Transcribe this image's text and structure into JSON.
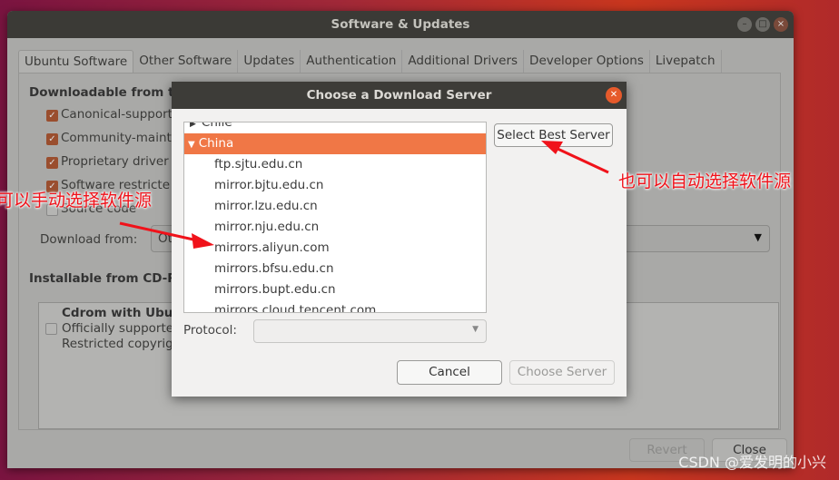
{
  "window": {
    "title": "Software & Updates",
    "controls": [
      "minimize",
      "maximize",
      "close"
    ]
  },
  "tabs": [
    "Ubuntu Software",
    "Other Software",
    "Updates",
    "Authentication",
    "Additional Drivers",
    "Developer Options",
    "Livepatch"
  ],
  "main": {
    "downloadable_heading": "Downloadable from th",
    "checkboxes": [
      {
        "label": "Canonical-support",
        "checked": true
      },
      {
        "label": "Community-mainta",
        "checked": true
      },
      {
        "label": "Proprietary driver",
        "checked": true
      },
      {
        "label": "Software restricte",
        "checked": true
      },
      {
        "label": "Source code",
        "checked": false
      }
    ],
    "download_from_label": "Download from:",
    "download_from_value": "Ot",
    "cdrom_heading": "Installable from CD-R",
    "cdrom": {
      "title": "Cdrom with Ubun",
      "line1": "Officially supporte",
      "line2": "Restricted copyrig",
      "checked": false
    },
    "revert": "Revert",
    "close": "Close"
  },
  "dialog": {
    "title": "Choose a Download Server",
    "countries": [
      {
        "name": "Chile",
        "expanded": false
      },
      {
        "name": "China",
        "expanded": true,
        "selected": true
      }
    ],
    "servers": [
      "ftp.sjtu.edu.cn",
      "mirror.bjtu.edu.cn",
      "mirror.lzu.edu.cn",
      "mirror.nju.edu.cn",
      "mirrors.aliyun.com",
      "mirrors.bfsu.edu.cn",
      "mirrors.bupt.edu.cn",
      "mirrors.cloud.tencent.com"
    ],
    "select_best": "Select Best Server",
    "protocol_label": "Protocol:",
    "protocol_value": "",
    "cancel": "Cancel",
    "choose": "Choose Server"
  },
  "annotations": {
    "manual": "可以手动选择软件源",
    "auto": "也可以自动选择软件源"
  },
  "watermark": "CSDN @爱发明的小兴",
  "colors": {
    "accent": "#f07746",
    "annotation": "#f0121a"
  }
}
